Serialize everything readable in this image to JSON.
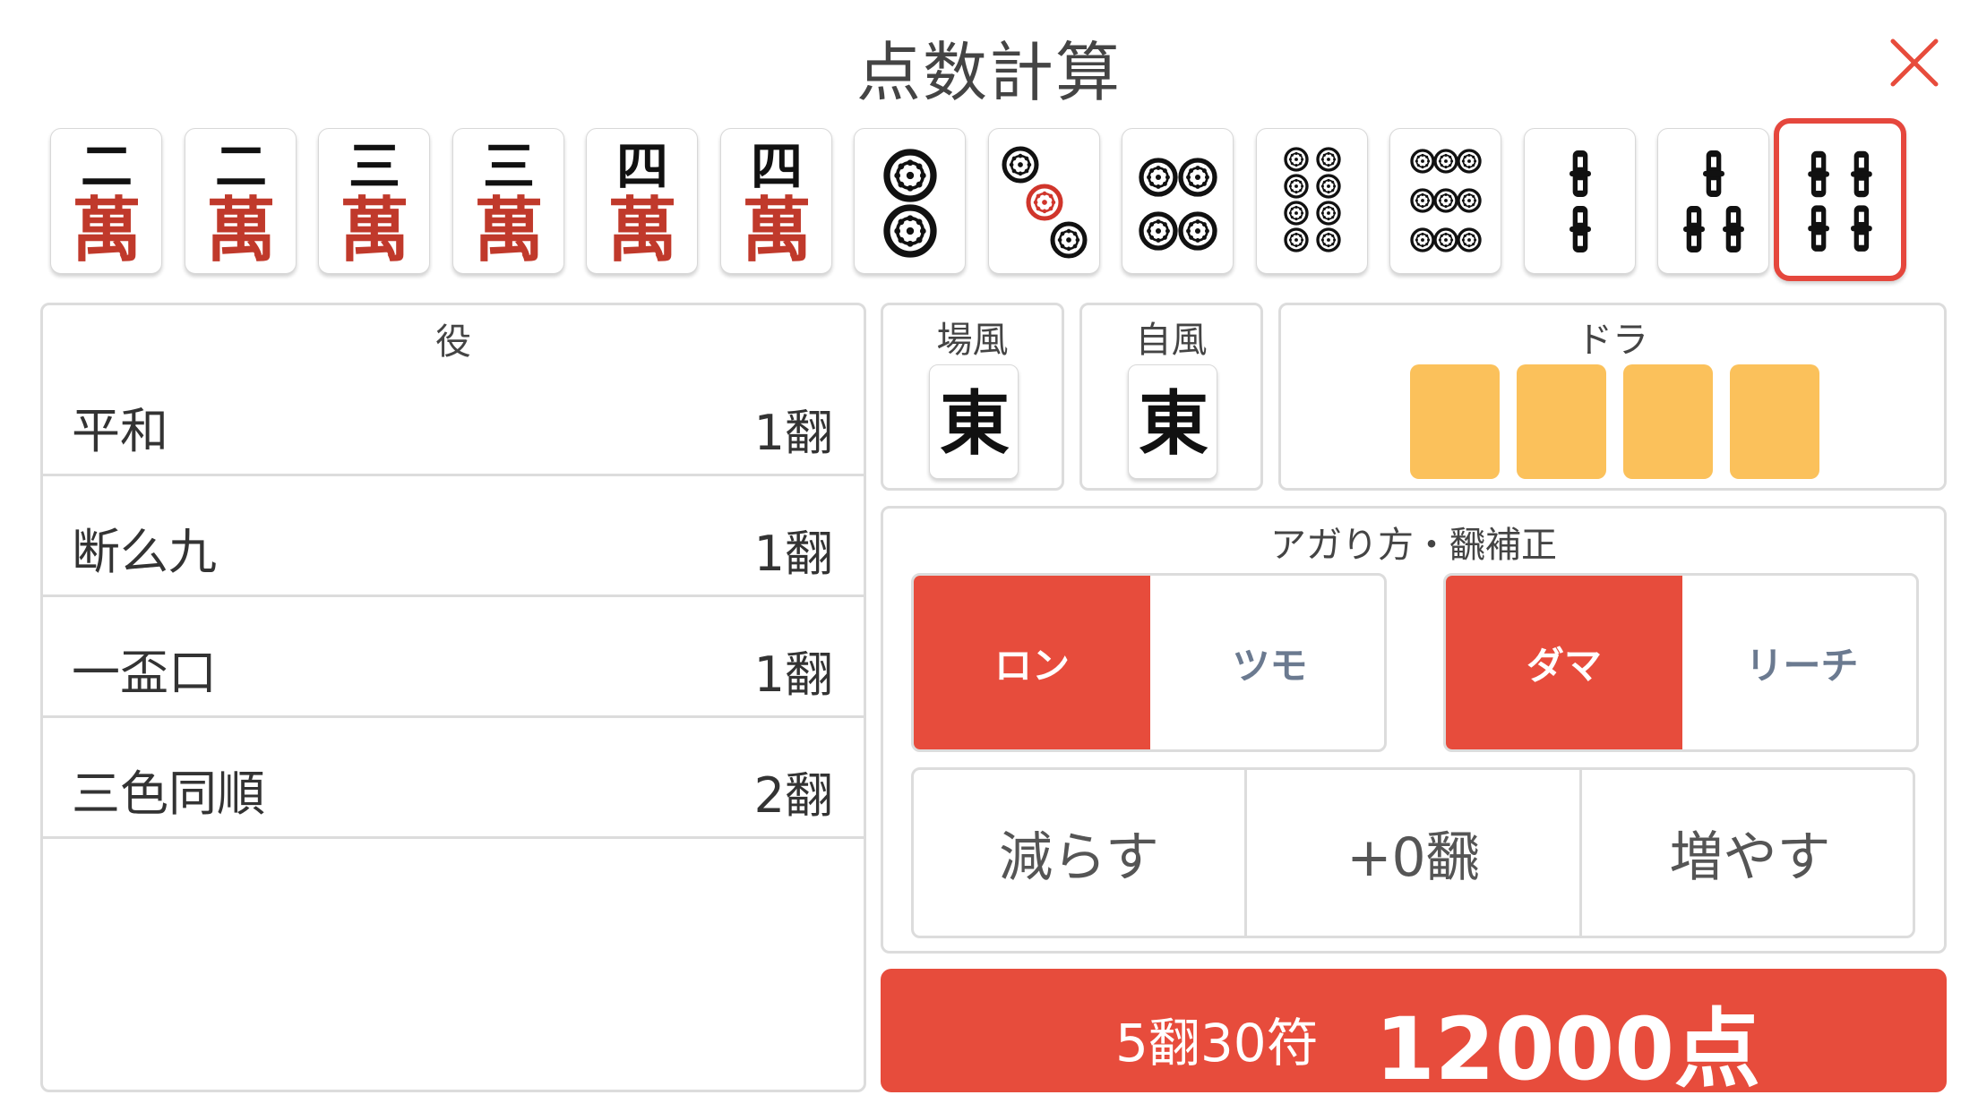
{
  "header": {
    "title": "点数計算",
    "close_icon": "close-icon"
  },
  "hand": {
    "tiles": [
      {
        "suit": "man",
        "rank": "二",
        "label": "萬",
        "selected": false
      },
      {
        "suit": "man",
        "rank": "二",
        "label": "萬",
        "selected": false
      },
      {
        "suit": "man",
        "rank": "三",
        "label": "萬",
        "selected": false
      },
      {
        "suit": "man",
        "rank": "三",
        "label": "萬",
        "selected": false
      },
      {
        "suit": "man",
        "rank": "四",
        "label": "萬",
        "selected": false
      },
      {
        "suit": "man",
        "rank": "四",
        "label": "萬",
        "selected": false
      },
      {
        "suit": "pin",
        "value": 2,
        "selected": false
      },
      {
        "suit": "pin",
        "value": 3,
        "selected": false
      },
      {
        "suit": "pin",
        "value": 4,
        "selected": false
      },
      {
        "suit": "pin",
        "value": 8,
        "selected": false
      },
      {
        "suit": "pin",
        "value": 9,
        "selected": false
      },
      {
        "suit": "sou",
        "value": 2,
        "selected": false
      },
      {
        "suit": "sou",
        "value": 3,
        "selected": false
      },
      {
        "suit": "sou",
        "value": 4,
        "selected": true
      }
    ]
  },
  "yaku": {
    "title": "役",
    "items": [
      {
        "name": "平和",
        "han": "1翻"
      },
      {
        "name": "断么九",
        "han": "1翻"
      },
      {
        "name": "一盃口",
        "han": "1翻"
      },
      {
        "name": "三色同順",
        "han": "2翻"
      }
    ]
  },
  "round_wind": {
    "title": "場風",
    "tile": "東"
  },
  "seat_wind": {
    "title": "自風",
    "tile": "東"
  },
  "dora": {
    "title": "ドラ",
    "slot_count": 4,
    "slot_color": "#fbc15b"
  },
  "agari": {
    "title": "アガり方・飜補正",
    "win_type": {
      "options": [
        "ロン",
        "ツモ"
      ],
      "selected": "ロン"
    },
    "riichi": {
      "options": [
        "ダマ",
        "リーチ"
      ],
      "selected": "ダマ"
    },
    "adjust": {
      "decrease": "減らす",
      "value": "+0飜",
      "increase": "増やす"
    }
  },
  "result": {
    "han_fu": "5翻30符",
    "points": "12000点"
  },
  "colors": {
    "accent": "#e74c3c",
    "man_red": "#c0392b",
    "pin_red": "#d0352b",
    "dora": "#fbc15b",
    "border": "#dcdcdc"
  }
}
